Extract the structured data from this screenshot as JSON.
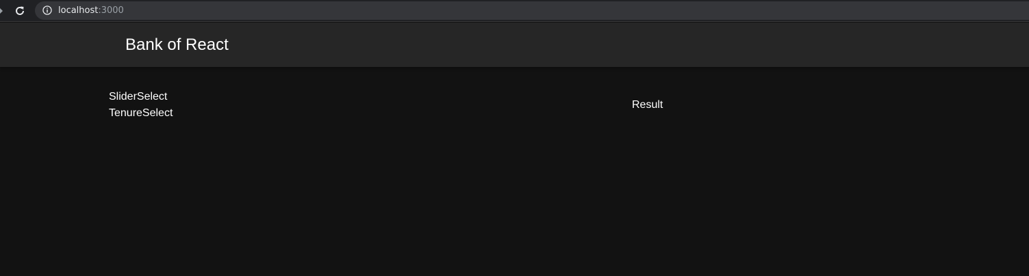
{
  "browser": {
    "url_host": "localhost",
    "url_port": ":3000",
    "icons": [
      "back-icon",
      "reload-icon",
      "info-icon"
    ]
  },
  "header": {
    "title": "Bank of React",
    "background": "#262626"
  },
  "main": {
    "background": "#121212",
    "left_components": [
      "SliderSelect",
      "TenureSelect"
    ],
    "result_label": "Result"
  }
}
